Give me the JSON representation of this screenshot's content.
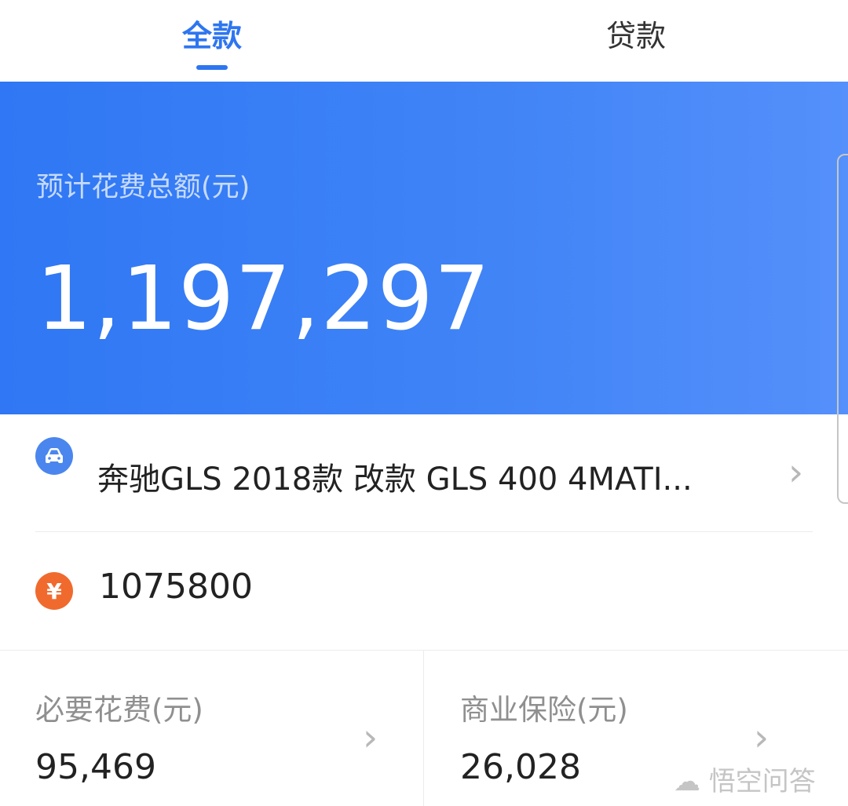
{
  "tabs": [
    {
      "label": "全款",
      "active": true
    },
    {
      "label": "贷款",
      "active": false
    }
  ],
  "hero": {
    "label": "预计花费总额(元)",
    "amount": "1,197,297"
  },
  "car": {
    "title": "奔驰GLS 2018款 改款 GLS 400 4MATI..."
  },
  "price": {
    "icon_symbol": "¥",
    "value": "1075800"
  },
  "summary": [
    {
      "label": "必要花费(元)",
      "value": "95,469"
    },
    {
      "label": "商业保险(元)",
      "value": "26,028"
    }
  ],
  "watermark": "悟空问答",
  "colors": {
    "accent": "#2e76f0",
    "car_icon": "#4a86ee",
    "price_icon": "#f06a2e"
  }
}
